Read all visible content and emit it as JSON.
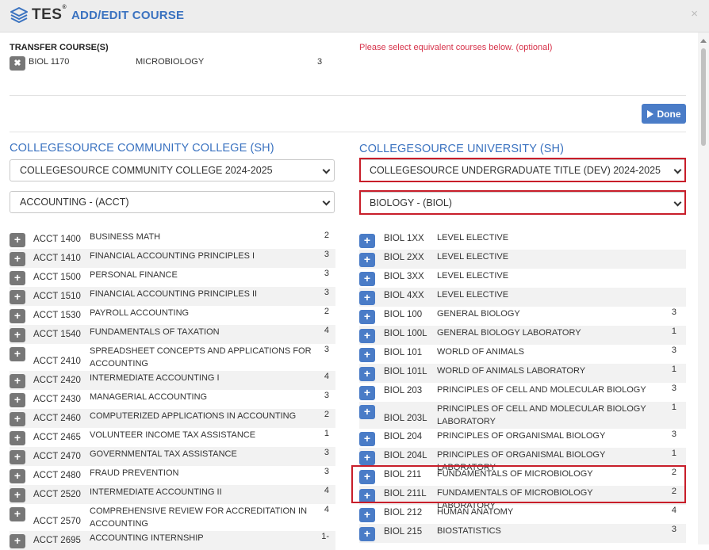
{
  "header": {
    "logo_text": "TES",
    "logo_sup": "®",
    "title": "ADD/EDIT COURSE",
    "close_symbol": "×"
  },
  "transfer": {
    "label": "TRANSFER COURSE(S)",
    "remove_symbol": "✖",
    "code": "BIOL 1170",
    "title": "MICROBIOLOGY",
    "credits": "3",
    "note": "Please select equivalent courses below. (optional)"
  },
  "done_label": "Done",
  "left": {
    "school": "COLLEGESOURCE COMMUNITY COLLEGE (SH)",
    "catalog": "COLLEGESOURCE COMMUNITY COLLEGE 2024-2025",
    "subject": "ACCOUNTING - (ACCT)",
    "courses": [
      {
        "code": "ACCT 1400",
        "title": "BUSINESS MATH",
        "credits": "2"
      },
      {
        "code": "ACCT 1410",
        "title": "FINANCIAL ACCOUNTING PRINCIPLES I",
        "credits": "3"
      },
      {
        "code": "ACCT 1500",
        "title": "PERSONAL FINANCE",
        "credits": "3"
      },
      {
        "code": "ACCT 1510",
        "title": "FINANCIAL ACCOUNTING PRINCIPLES II",
        "credits": "3"
      },
      {
        "code": "ACCT 1530",
        "title": "PAYROLL ACCOUNTING",
        "credits": "2"
      },
      {
        "code": "ACCT 1540",
        "title": "FUNDAMENTALS OF TAXATION",
        "credits": "4"
      },
      {
        "code": "ACCT 2410",
        "title": "SPREADSHEET CONCEPTS AND APPLICATIONS FOR ACCOUNTING",
        "credits": "3"
      },
      {
        "code": "ACCT 2420",
        "title": "INTERMEDIATE ACCOUNTING I",
        "credits": "4"
      },
      {
        "code": "ACCT 2430",
        "title": "MANAGERIAL ACCOUNTING",
        "credits": "3"
      },
      {
        "code": "ACCT 2460",
        "title": "COMPUTERIZED APPLICATIONS IN ACCOUNTING",
        "credits": "2"
      },
      {
        "code": "ACCT 2465",
        "title": "VOLUNTEER INCOME TAX ASSISTANCE",
        "credits": "1"
      },
      {
        "code": "ACCT 2470",
        "title": "GOVERNMENTAL TAX ASSISTANCE",
        "credits": "3"
      },
      {
        "code": "ACCT 2480",
        "title": "FRAUD PREVENTION",
        "credits": "3"
      },
      {
        "code": "ACCT 2520",
        "title": "INTERMEDIATE ACCOUNTING II",
        "credits": "4"
      },
      {
        "code": "ACCT 2570",
        "title": "COMPREHENSIVE REVIEW FOR ACCREDITATION IN ACCOUNTING",
        "credits": "4"
      },
      {
        "code": "ACCT 2695",
        "title": "ACCOUNTING INTERNSHIP",
        "credits": "1-"
      }
    ]
  },
  "right": {
    "school": "COLLEGESOURCE UNIVERSITY (SH)",
    "catalog": "COLLEGESOURCE UNDERGRADUATE TITLE (DEV) 2024-2025",
    "subject": "BIOLOGY - (BIOL)",
    "courses": [
      {
        "code": "BIOL 1XX",
        "title": "LEVEL ELECTIVE",
        "credits": ""
      },
      {
        "code": "BIOL 2XX",
        "title": "LEVEL ELECTIVE",
        "credits": ""
      },
      {
        "code": "BIOL 3XX",
        "title": "LEVEL ELECTIVE",
        "credits": ""
      },
      {
        "code": "BIOL 4XX",
        "title": "LEVEL ELECTIVE",
        "credits": ""
      },
      {
        "code": "BIOL 100",
        "title": "GENERAL BIOLOGY",
        "credits": "3"
      },
      {
        "code": "BIOL 100L",
        "title": "GENERAL BIOLOGY LABORATORY",
        "credits": "1"
      },
      {
        "code": "BIOL 101",
        "title": "WORLD OF ANIMALS",
        "credits": "3"
      },
      {
        "code": "BIOL 101L",
        "title": "WORLD OF ANIMALS LABORATORY",
        "credits": "1"
      },
      {
        "code": "BIOL 203",
        "title": "PRINCIPLES OF CELL AND MOLECULAR BIOLOGY",
        "credits": "3"
      },
      {
        "code": "BIOL 203L",
        "title": "PRINCIPLES OF CELL AND MOLECULAR BIOLOGY LABORATORY",
        "credits": "1"
      },
      {
        "code": "BIOL 204",
        "title": "PRINCIPLES OF ORGANISMAL BIOLOGY",
        "credits": "3"
      },
      {
        "code": "BIOL 204L",
        "title": "PRINCIPLES OF ORGANISMAL BIOLOGY LABORATORY",
        "credits": "1"
      },
      {
        "code": "BIOL 211",
        "title": "FUNDAMENTALS OF MICROBIOLOGY",
        "credits": "2"
      },
      {
        "code": "BIOL 211L",
        "title": "FUNDAMENTALS OF MICROBIOLOGY LABORATORY",
        "credits": "2"
      },
      {
        "code": "BIOL 212",
        "title": "HUMAN ANATOMY",
        "credits": "4"
      },
      {
        "code": "BIOL 215",
        "title": "BIOSTATISTICS",
        "credits": "3"
      }
    ]
  },
  "add_symbol": "+",
  "colors": {
    "accent": "#3a72c0",
    "button_blue": "#4a7cc7",
    "highlight_red": "#c81e2a",
    "note_red": "#d6324a"
  }
}
